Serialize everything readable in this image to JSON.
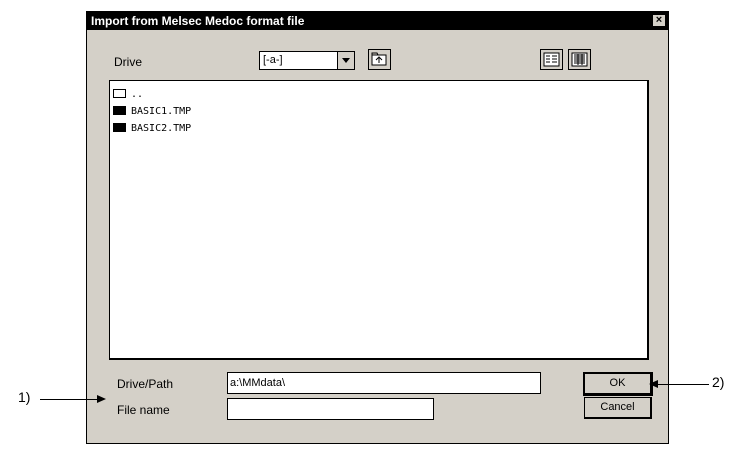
{
  "dialog": {
    "title": "Import from Melsec Medoc format file",
    "close_label": "×"
  },
  "drive": {
    "label": "Drive",
    "selected": "[-a-]"
  },
  "icons": {
    "up_folder": "up-folder-icon",
    "list_view": "list-view-icon",
    "details_view": "details-view-icon"
  },
  "file_list": {
    "items": [
      {
        "name": "..",
        "icon": "open-folder-icon"
      },
      {
        "name": "BASIC1.TMP",
        "icon": "folder-icon"
      },
      {
        "name": "BASIC2.TMP",
        "icon": "folder-icon"
      }
    ]
  },
  "drive_path": {
    "label": "Drive/Path",
    "value": "a:\\MMdata\\"
  },
  "file_name": {
    "label": "File name",
    "value": ""
  },
  "buttons": {
    "ok": "OK",
    "cancel": "Cancel"
  },
  "callouts": {
    "one": "1)",
    "two": "2)"
  }
}
